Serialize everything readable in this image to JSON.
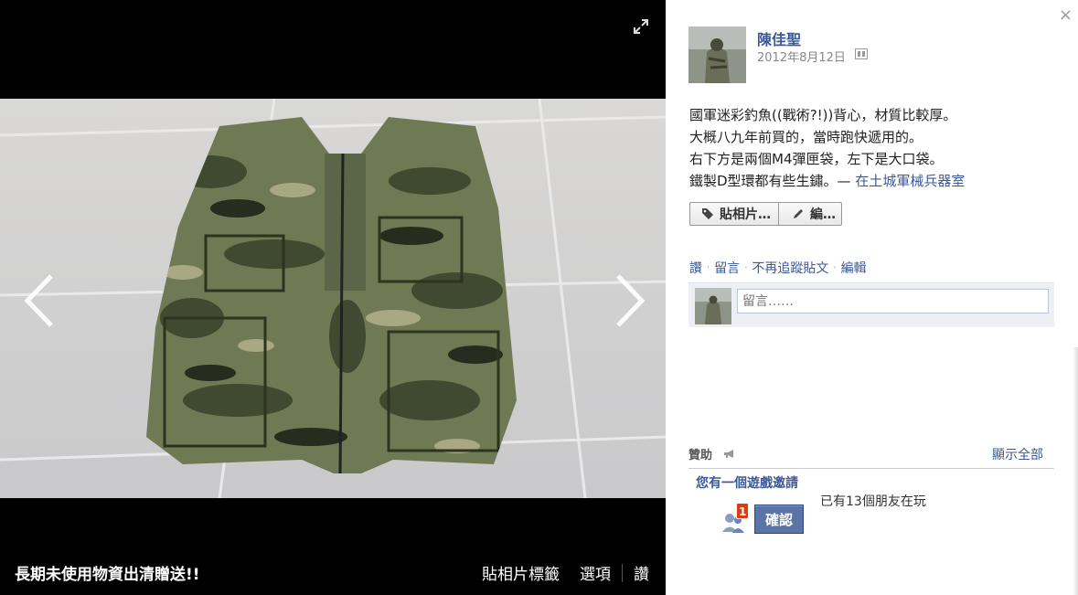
{
  "stage": {
    "album_title": "長期未使用物資出清贈送!!",
    "actions": {
      "tag_photo": "貼相片標籤",
      "options": "選項",
      "like": "讚"
    }
  },
  "panel": {
    "author_name": "陳佳聖",
    "post_date": "2012年8月12日",
    "caption_lines": [
      "國軍迷彩釣魚((戰術?!))背心，材質比較厚。",
      "大概八九年前買的，當時跑快遞用的。",
      "右下方是兩個M4彈匣袋，左下是大口袋。",
      "鐵製D型環都有些生鏽。— "
    ],
    "location": "在土城軍械兵器室",
    "buttons": {
      "tag": "貼相片…",
      "edit": "編…"
    },
    "ufi_links": {
      "like": "讚",
      "comment": "留言",
      "unfollow": "不再追蹤貼文",
      "edit": "編輯"
    },
    "comment_placeholder": "留言……",
    "sponsored": {
      "label": "贊助",
      "see_all": "顯示全部",
      "invite_title": "您有一個遊戲邀請",
      "badge_count": "1",
      "confirm": "確認",
      "friends_playing": "已有13個朋友在玩"
    }
  },
  "colors": {
    "link": "#3b5998",
    "stage_bg": "#000000",
    "badge": "#dd3c10",
    "confirm_button": "#5b74a8"
  }
}
